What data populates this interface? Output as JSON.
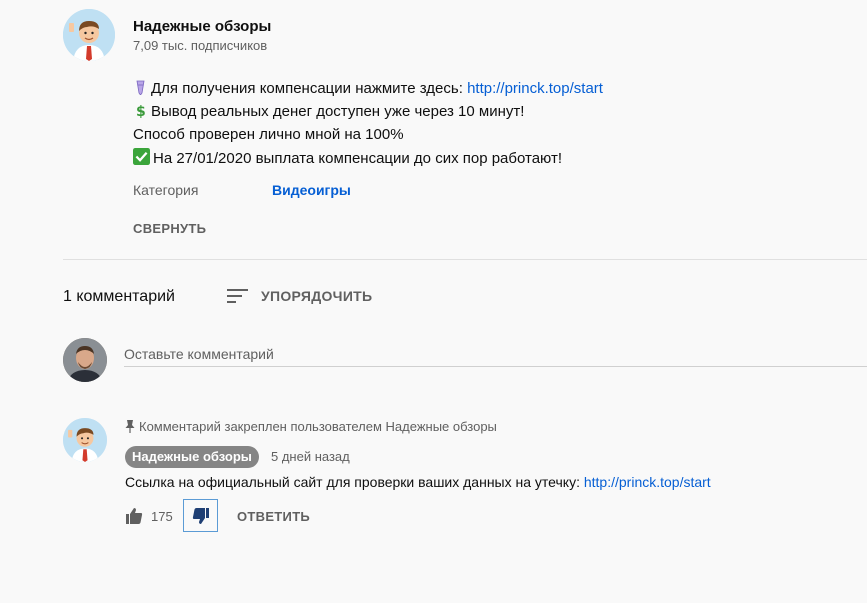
{
  "channel": {
    "name": "Надежные обзоры",
    "subscribers": "7,09 тыс. подписчиков"
  },
  "description": {
    "line1_text": "Для получения компенсации нажмите здесь: ",
    "line1_link": "http://princk.top/start",
    "line2_text": "Вывод реальных денег доступен уже через 10 минут!",
    "line3_text": "Способ проверен лично мной на 100%",
    "line4_text": "На 27/01/2020 выплата компенсации до сих пор работают!",
    "category_label": "Категория",
    "category_value": "Видеоигры",
    "collapse_label": "СВЕРНУТЬ"
  },
  "comments_header": {
    "count": "1 комментарий",
    "sort_label": "УПОРЯДОЧИТЬ"
  },
  "comment_input": {
    "placeholder": "Оставьте комментарий"
  },
  "pinned_comment": {
    "pinned_text": "Комментарий закреплен пользователем Надежные обзоры",
    "author": "Надежные обзоры",
    "time": "5 дней назад",
    "text": "Ссылка на официальный сайт для проверки ваших данных на утечку: ",
    "link": "http://princk.top/start",
    "likes": "175",
    "reply_label": "ОТВЕТИТЬ"
  },
  "colors": {
    "link": "#065fd4",
    "badge": "#858585",
    "dislike_border": "#5b9bd5"
  },
  "icons": [
    "pen-emoji-icon",
    "dollar-emoji-icon",
    "check-emoji-icon",
    "sort-icon",
    "pin-icon",
    "thumb-up-icon",
    "thumb-down-icon"
  ]
}
